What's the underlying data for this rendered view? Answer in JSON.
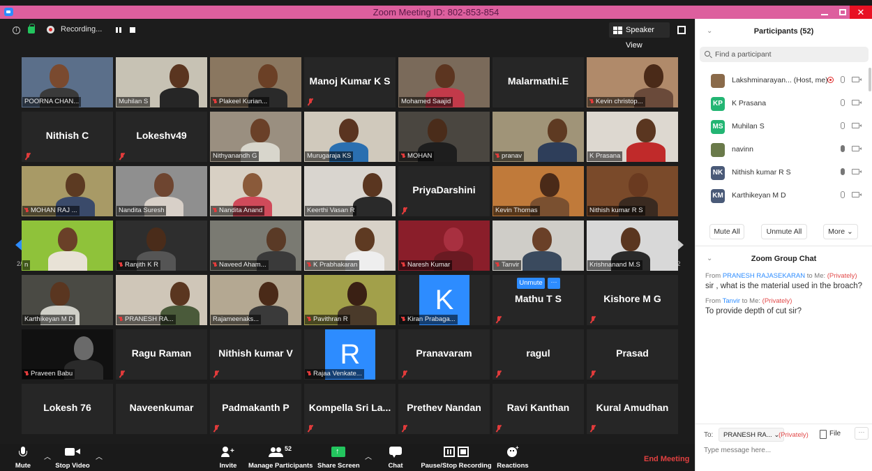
{
  "window": {
    "title": "Zoom Meeting ID: 802-853-854"
  },
  "top_status": {
    "recording_label": "Recording...",
    "speaker_view_label": "Speaker View"
  },
  "pagination": {
    "left": "2/2",
    "right": "2/2"
  },
  "tiles": [
    {
      "type": "video",
      "label": "POORNA CHAN...",
      "muted": false,
      "bg": "#5b6f8a",
      "skin": "#7a4a2f",
      "shirt": "#3a3a3a"
    },
    {
      "type": "video",
      "label": "Muhilan S",
      "muted": false,
      "bg": "#c7c2b4",
      "skin": "#5a3520",
      "shirt": "#262626"
    },
    {
      "type": "video",
      "label": "Plakeel Kurian...",
      "muted": true,
      "bg": "#8a7760",
      "skin": "#6b4026",
      "shirt": "#2a2a2a"
    },
    {
      "type": "name",
      "name": "Manoj Kumar K S",
      "muted": true
    },
    {
      "type": "video",
      "label": "Mohamed Saajid",
      "muted": false,
      "bg": "#7a6a5a",
      "skin": "#5c3520",
      "shirt": "#c23a4a"
    },
    {
      "type": "name",
      "name": "Malarmathi.E",
      "muted": false
    },
    {
      "type": "video",
      "label": "Kevin christop...",
      "muted": true,
      "bg": "#b08a6a",
      "skin": "#4a2a18",
      "shirt": "#6a4a3a"
    },
    {
      "type": "name",
      "name": "Nithish C",
      "muted": true
    },
    {
      "type": "name",
      "name": "Lokeshv49",
      "muted": true
    },
    {
      "type": "video",
      "label": "Nithyanandh G",
      "muted": false,
      "bg": "#9a8f80",
      "skin": "#6a4028",
      "shirt": "#d8d6cc"
    },
    {
      "type": "video",
      "label": "Murugaraja KS",
      "muted": false,
      "bg": "#d0c9bc",
      "skin": "#5a3420",
      "shirt": "#2a6fb0"
    },
    {
      "type": "video",
      "label": "MOHAN",
      "muted": true,
      "bg": "#4a4640",
      "skin": "#4a2c1a",
      "shirt": "#1e1e1e"
    },
    {
      "type": "video",
      "label": "pranav",
      "muted": true,
      "bg": "#a09478",
      "skin": "#5e3a22",
      "shirt": "#2e3e5a"
    },
    {
      "type": "video",
      "label": "K Prasana",
      "muted": false,
      "bg": "#ddd8d0",
      "skin": "#5a3620",
      "shirt": "#c02a2a"
    },
    {
      "type": "video",
      "label": "MOHAN RAJ ...",
      "muted": true,
      "bg": "#a89a66",
      "skin": "#5c3a22",
      "shirt": "#3a4a6a"
    },
    {
      "type": "video",
      "label": "Nandita Suresh",
      "muted": false,
      "bg": "#8f8f8f",
      "skin": "#6e4530",
      "shirt": "#d8d0c8"
    },
    {
      "type": "video",
      "label": "Nandita Anand",
      "muted": true,
      "bg": "#d8d0c4",
      "skin": "#8a5a3a",
      "shirt": "#d04a5a"
    },
    {
      "type": "video",
      "label": "Keerthi Vasan R",
      "muted": false,
      "bg": "#d9d5cf",
      "skin": "#5a3620",
      "shirt": "#2a2a2a"
    },
    {
      "type": "name",
      "name": "PriyaDarshini",
      "muted": true
    },
    {
      "type": "video",
      "label": "Kevin Thomas",
      "muted": false,
      "bg": "#c07a3a",
      "skin": "#4a2a18",
      "shirt": "#7a5030"
    },
    {
      "type": "video",
      "label": "Nithish kumar R S",
      "muted": false,
      "bg": "#7a4a2a",
      "skin": "#6a3a20",
      "shirt": "#3a2a20",
      "active": true
    },
    {
      "type": "video",
      "label": "n",
      "muted": false,
      "bg": "#8fc23a",
      "skin": "#6a4028",
      "shirt": "#e8e2d6",
      "active": true
    },
    {
      "type": "video",
      "label": "Ranjith K R",
      "muted": true,
      "bg": "#2e2e2e",
      "skin": "#4a2c1a",
      "shirt": "#555555"
    },
    {
      "type": "video",
      "label": "Naveed Aham...",
      "muted": true,
      "bg": "#7a7a72",
      "skin": "#5a3a26",
      "shirt": "#3a3a3a"
    },
    {
      "type": "video",
      "label": "K Prabhakaran",
      "muted": true,
      "bg": "#d8d2c8",
      "skin": "#5e3a22",
      "shirt": "#eeeeee"
    },
    {
      "type": "video",
      "label": "Naresh Kumar",
      "muted": true,
      "bg": "#8a1e2a",
      "skin": "#a83040",
      "shirt": "#6a1a22"
    },
    {
      "type": "video",
      "label": "Tanvir",
      "muted": true,
      "bg": "#cfcdc8",
      "skin": "#6a4028",
      "shirt": "#3a4a5e"
    },
    {
      "type": "video",
      "label": "Krishnanand M.S",
      "muted": false,
      "bg": "#d8d8d8",
      "skin": "#5a3620",
      "shirt": "#2a2a2a"
    },
    {
      "type": "video",
      "label": "Karthikeyan M D",
      "muted": false,
      "bg": "#4a4a44",
      "skin": "#5a3620",
      "shirt": "#d0d0c8"
    },
    {
      "type": "video",
      "label": "PRANESH RA...",
      "muted": true,
      "bg": "#cfc6b8",
      "skin": "#5a3620",
      "shirt": "#4a5a3a"
    },
    {
      "type": "video",
      "label": "Rajameenaks...",
      "muted": false,
      "bg": "#b4a892",
      "skin": "#4a2a18",
      "shirt": "#3a3a3a"
    },
    {
      "type": "video",
      "label": "Pavithran R",
      "muted": true,
      "bg": "#a2a04a",
      "skin": "#3a2014",
      "shirt": "#4a3a2a"
    },
    {
      "type": "letter",
      "letter": "K",
      "label": "Kiran Prabaga...",
      "muted": true
    },
    {
      "type": "name",
      "name": "Mathu T S",
      "muted": true,
      "unmute": "Unmute"
    },
    {
      "type": "name",
      "name": "Kishore M G",
      "muted": true
    },
    {
      "type": "video",
      "label": "Praveen Babu",
      "muted": true,
      "bg": "#111111",
      "skin": "#6a6a6a",
      "shirt": "#2a2a2a"
    },
    {
      "type": "name",
      "name": "Ragu Raman",
      "muted": true
    },
    {
      "type": "name",
      "name": "Nithish kumar V",
      "muted": true
    },
    {
      "type": "letter",
      "letter": "R",
      "label": "Rajaa Venkate...",
      "muted": true
    },
    {
      "type": "name",
      "name": "Pranavaram",
      "muted": true
    },
    {
      "type": "name",
      "name": "ragul",
      "muted": true
    },
    {
      "type": "name",
      "name": "Prasad",
      "muted": true
    },
    {
      "type": "name",
      "name": "Lokesh 76",
      "muted": false
    },
    {
      "type": "name",
      "name": "Naveenkumar",
      "muted": false
    },
    {
      "type": "name",
      "name": "Padmakanth P",
      "muted": true
    },
    {
      "type": "name",
      "name": "Kompella Sri La...",
      "muted": true
    },
    {
      "type": "name",
      "name": "Prethev Nandan",
      "muted": true
    },
    {
      "type": "name",
      "name": "Ravi Kanthan",
      "muted": true
    },
    {
      "type": "name",
      "name": "Kural Amudhan",
      "muted": true
    }
  ],
  "toolbar": {
    "mute": "Mute",
    "stop_video": "Stop Video",
    "invite": "Invite",
    "manage_participants": "Manage Participants",
    "participant_count": "52",
    "share_screen": "Share Screen",
    "chat": "Chat",
    "pause_stop_recording": "Pause/Stop Recording",
    "reactions": "Reactions",
    "end_meeting": "End Meeting"
  },
  "participants_panel": {
    "title": "Participants (52)",
    "search_placeholder": "Find a participant",
    "items": [
      {
        "name": "Lakshminarayan... (Host, me)",
        "avatar": "photo",
        "color": "#8a6a4a",
        "mic": "off",
        "rec": true
      },
      {
        "name": "K Prasana",
        "avatar": "KP",
        "color": "#23b573",
        "mic": "off",
        "rec": false
      },
      {
        "name": "Muhilan S",
        "avatar": "MS",
        "color": "#23b573",
        "mic": "off",
        "rec": false
      },
      {
        "name": "navinn",
        "avatar": "photo",
        "color": "#6a7a4a",
        "mic": "on",
        "rec": false
      },
      {
        "name": "Nithish kumar R S",
        "avatar": "NK",
        "color": "#4a5a78",
        "mic": "on",
        "rec": false
      },
      {
        "name": "Karthikeyan M D",
        "avatar": "KM",
        "color": "#4a5a78",
        "mic": "off",
        "rec": false
      }
    ],
    "mute_all": "Mute All",
    "unmute_all": "Unmute All",
    "more": "More"
  },
  "chat_panel": {
    "title": "Zoom Group Chat",
    "messages": [
      {
        "from_prefix": "From",
        "from": "PRANESH RAJASEKARAN",
        "to_text": "to Me:",
        "privately": "(Privately)",
        "text": "sir , what is the material used in the broach?"
      },
      {
        "from_prefix": "From",
        "from": "Tanvir",
        "to_text": "to Me:",
        "privately": "(Privately)",
        "text": "To provide depth of cut sir?"
      }
    ],
    "to_label": "To:",
    "to_value": "PRANESH RA...",
    "to_privately": "(Privately)",
    "file_label": "File",
    "input_placeholder": "Type message here..."
  }
}
